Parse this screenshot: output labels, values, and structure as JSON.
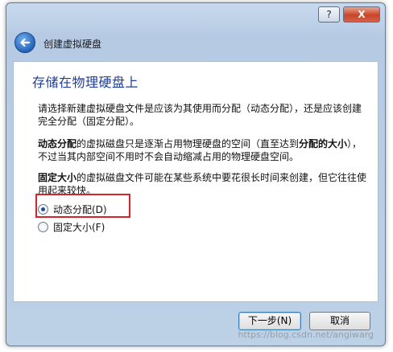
{
  "window": {
    "help_label": "?",
    "close_label": "X"
  },
  "wizard": {
    "title": "创建虚拟硬盘"
  },
  "page": {
    "heading": "存储在物理硬盘上",
    "intro": "请选择新建虚拟硬盘文件是应该为其使用而分配（动态分配），还是应该创建完全分配（固定分配）。",
    "dynamic_desc_bold_start": "动态分配",
    "dynamic_desc_mid": "的虚拟磁盘只是逐渐占用物理硬盘的空间（直至达到",
    "dynamic_desc_bold_mid": "分配的大小",
    "dynamic_desc_end": "），不过当其内部空间不用时不会自动缩减占用的物理硬盘空间。",
    "fixed_desc_bold": "固定大小",
    "fixed_desc_rest": "的虚拟磁盘文件可能在某些系统中要花很长时间来创建，但它往往使用起来较快。"
  },
  "options": [
    {
      "label": "动态分配(D)",
      "checked": true
    },
    {
      "label": "固定大小(F)",
      "checked": false
    }
  ],
  "buttons": {
    "next": "下一步(N)",
    "cancel": "取消"
  },
  "watermark": "https://blog.csdn.net/angiwarg",
  "colors": {
    "heading": "#1f3d99",
    "highlight": "#d6222a"
  }
}
